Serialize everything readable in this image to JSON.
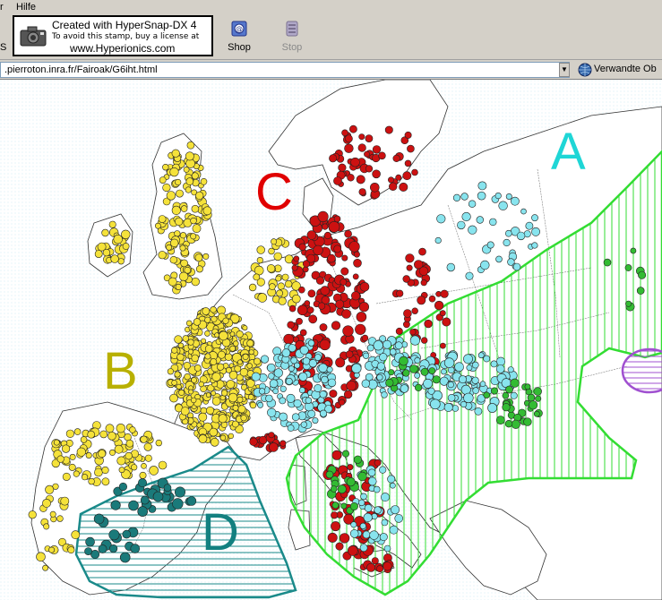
{
  "menubar": {
    "items": [
      "r",
      "Hilfe"
    ]
  },
  "stamp": {
    "line1": "Created with HyperSnap-DX 4",
    "line2": "To avoid this stamp, buy a license at",
    "line3": "www.Hyperionics.com"
  },
  "toolbar": {
    "left_cut": "S",
    "shop_label": "Shop",
    "stop_label": "Stop"
  },
  "address": {
    "url": ".pierroton.inra.fr/Fairoak/G6iht.html",
    "related": "Verwandte Ob"
  },
  "map": {
    "zone_labels": {
      "a": "A",
      "b": "B",
      "c": "C",
      "d": "D"
    },
    "colors": {
      "zone_a": "#1fd6d6",
      "zone_b": "#b8b000",
      "zone_c": "#e00000",
      "zone_d": "#138080",
      "green_hatch": "#33dd33",
      "teal_hatch": "#1a8a8a",
      "purple_hatch": "#a050d0",
      "dot_yellow": "#f5e23a",
      "dot_red": "#cc1111",
      "dot_cyan": "#88e4ee",
      "dot_green": "#33bb33",
      "dot_teal": "#1a7a7a"
    }
  }
}
